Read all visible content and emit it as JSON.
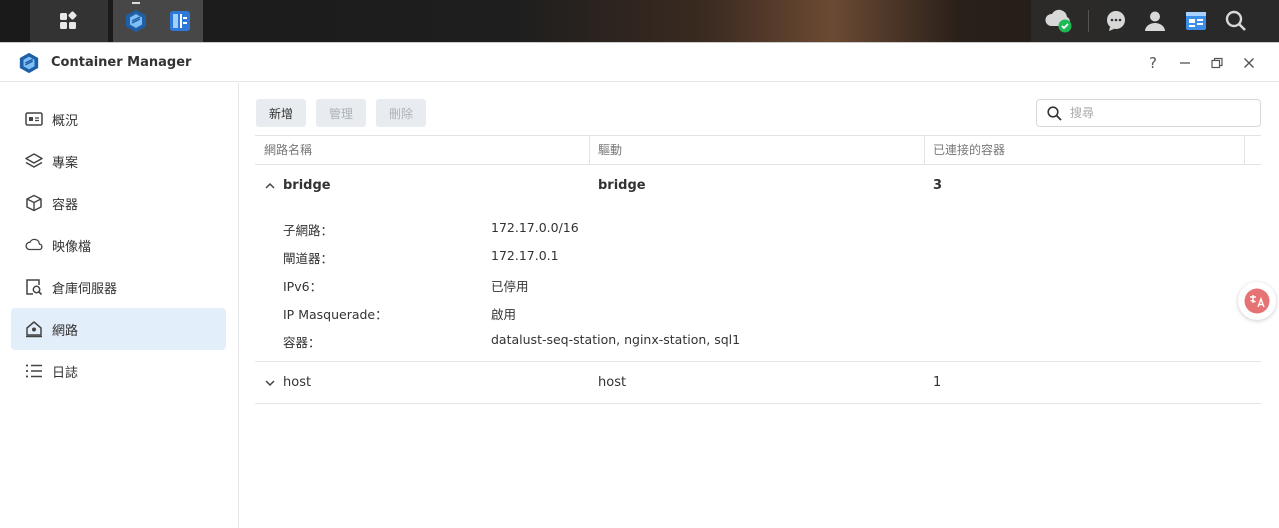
{
  "window": {
    "title": "Container Manager",
    "controls": {
      "help": "?",
      "minimize": "—",
      "restore": "🗗",
      "close": "✕"
    }
  },
  "sidebar": {
    "items": [
      {
        "label": "概況",
        "icon": "overview-icon"
      },
      {
        "label": "專案",
        "icon": "layers-icon"
      },
      {
        "label": "容器",
        "icon": "cube-icon"
      },
      {
        "label": "映像檔",
        "icon": "cloud-icon"
      },
      {
        "label": "倉庫伺服器",
        "icon": "registry-icon"
      },
      {
        "label": "網路",
        "icon": "network-home-icon",
        "active": true
      },
      {
        "label": "日誌",
        "icon": "list-icon"
      }
    ]
  },
  "toolbar": {
    "add_label": "新增",
    "manage_label": "管理",
    "delete_label": "刪除",
    "search_placeholder": "搜尋"
  },
  "table": {
    "columns": [
      "網路名稱",
      "驅動",
      "已連接的容器"
    ],
    "rows": [
      {
        "name": "bridge",
        "driver": "bridge",
        "connected": "3",
        "expanded": true,
        "details": [
          {
            "label": "子網路：",
            "value": "172.17.0.0/16"
          },
          {
            "label": "閘道器：",
            "value": "172.17.0.1"
          },
          {
            "label": "IPv6：",
            "value": "已停用"
          },
          {
            "label": "IP Masquerade：",
            "value": "啟用"
          },
          {
            "label": "容器：",
            "value": "datalust-seq-station, nginx-station, sql1"
          }
        ]
      },
      {
        "name": "host",
        "driver": "host",
        "connected": "1",
        "expanded": false
      }
    ]
  },
  "colors": {
    "accent": "#2b7de9",
    "active_bg": "#e3eefb",
    "check_green": "#1db954"
  }
}
